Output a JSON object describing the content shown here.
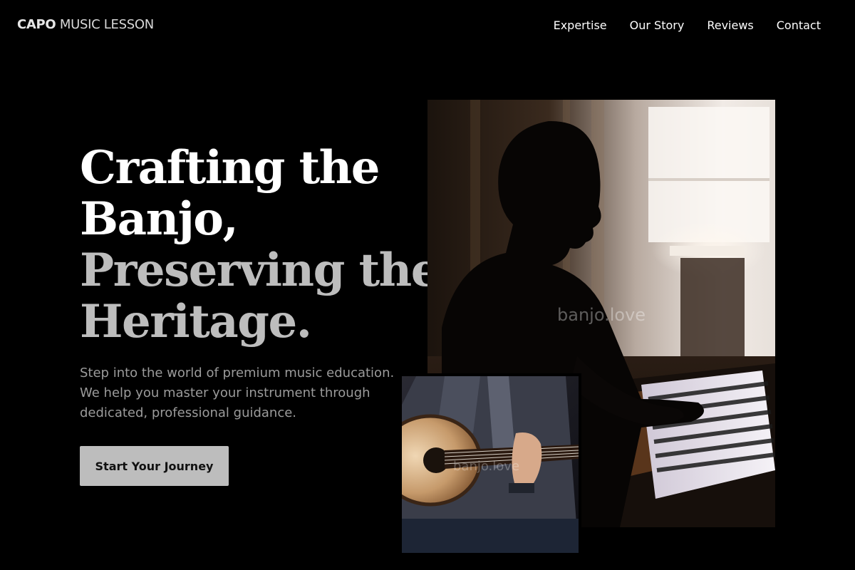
{
  "header": {
    "brand_strong": "CAPO",
    "brand_rest": "MUSIC LESSON",
    "nav": [
      {
        "label": "Expertise"
      },
      {
        "label": "Our Story"
      },
      {
        "label": "Reviews"
      },
      {
        "label": "Contact"
      }
    ]
  },
  "hero": {
    "title_lines": [
      {
        "text": "Crafting the",
        "tone": "light"
      },
      {
        "text": "Banjo,",
        "tone": "light"
      },
      {
        "text": "Preserving the",
        "tone": "muted"
      },
      {
        "text": "Heritage.",
        "tone": "muted"
      }
    ],
    "subtitle": "Step into the world of premium music education. We help you master your instrument through dedicated, professional guidance.",
    "cta_label": "Start Your Journey"
  },
  "images": {
    "main": {
      "subject": "boy-playing-piano-silhouette",
      "watermark": "banjo.love"
    },
    "inset": {
      "subject": "person-playing-acoustic-guitar",
      "watermark": "banjo.love"
    }
  },
  "colors": {
    "background": "#000000",
    "title_light": "#ffffff",
    "title_muted": "#bdbdbd",
    "subtitle": "#9b9b9b",
    "cta_bg": "#bdbdbd",
    "cta_text": "#111111"
  }
}
